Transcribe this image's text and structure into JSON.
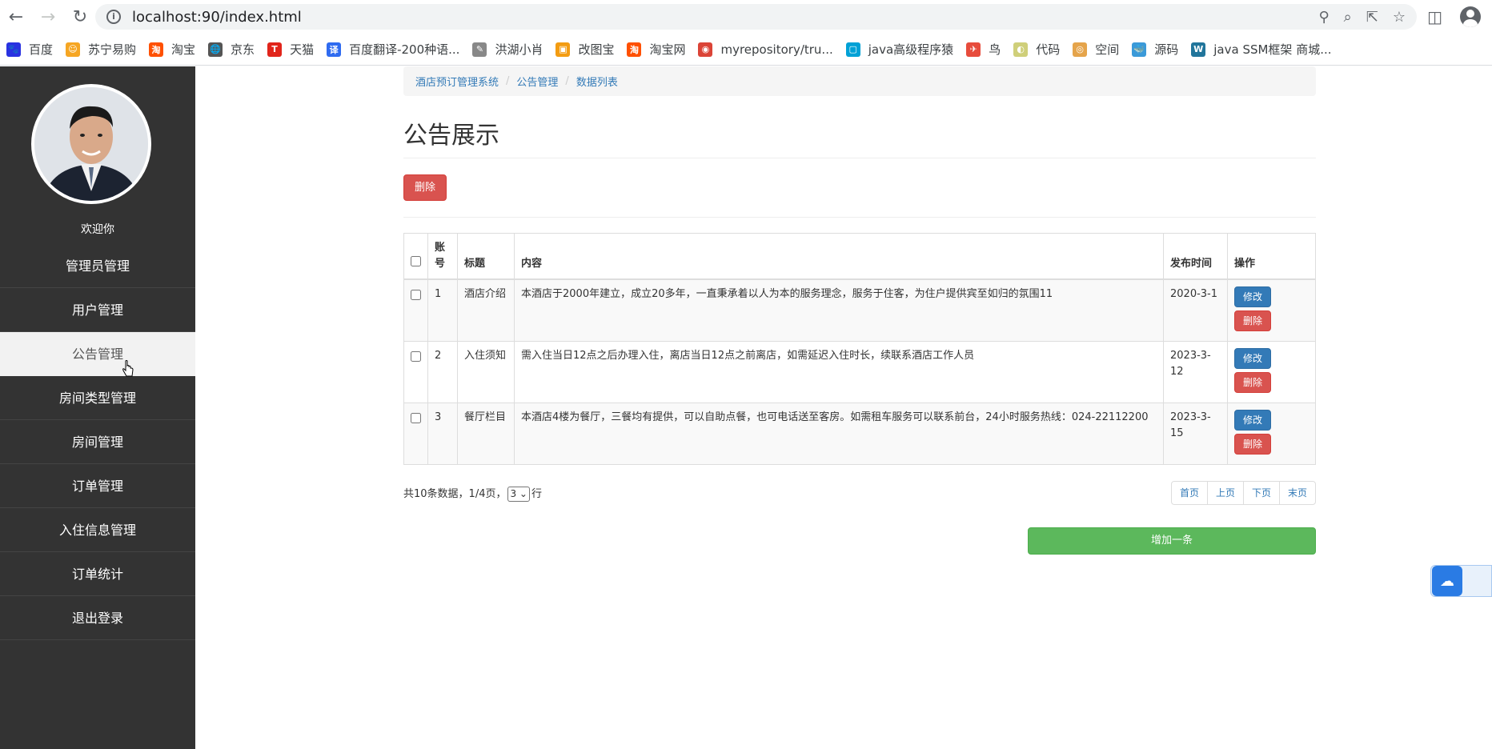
{
  "browser": {
    "url": "localhost:90/index.html",
    "bookmarks": [
      {
        "label": "百度",
        "icon": "baidu-icon",
        "color": "#2932e1",
        "glyph": "🐾"
      },
      {
        "label": "苏宁易购",
        "icon": "suning-icon",
        "color": "#f6a623",
        "glyph": "☺"
      },
      {
        "label": "淘宝",
        "icon": "taobao-icon",
        "color": "#ff5000",
        "glyph": "淘"
      },
      {
        "label": "京东",
        "icon": "jd-icon",
        "color": "#555555",
        "glyph": "🌐"
      },
      {
        "label": "天猫",
        "icon": "tmall-icon",
        "color": "#e1251b",
        "glyph": "T"
      },
      {
        "label": "百度翻译-200种语...",
        "icon": "baidu-translate-icon",
        "color": "#2f6bf0",
        "glyph": "译"
      },
      {
        "label": "洪湖小肖",
        "icon": "hhxx-icon",
        "color": "#888888",
        "glyph": "✎"
      },
      {
        "label": "改图宝",
        "icon": "gaitubao-icon",
        "color": "#f39c12",
        "glyph": "▣"
      },
      {
        "label": "淘宝网",
        "icon": "taobao-net-icon",
        "color": "#ff5000",
        "glyph": "淘"
      },
      {
        "label": "myrepository/tru...",
        "icon": "chrome-icon",
        "color": "#db4437",
        "glyph": "◉"
      },
      {
        "label": "java高级程序猿",
        "icon": "bilibili-icon",
        "color": "#00a1d6",
        "glyph": "▢"
      },
      {
        "label": "鸟",
        "icon": "bird-icon",
        "color": "#e74c3c",
        "glyph": "✈"
      },
      {
        "label": "代码",
        "icon": "code-icon",
        "color": "#cfcf7a",
        "glyph": "◐"
      },
      {
        "label": "空间",
        "icon": "qzone-icon",
        "color": "#e5a44b",
        "glyph": "◎"
      },
      {
        "label": "源码",
        "icon": "source-icon",
        "color": "#3b9ad9",
        "glyph": "🐳"
      },
      {
        "label": "java SSM框架 商城...",
        "icon": "wordpress-icon",
        "color": "#21759b",
        "glyph": "W"
      }
    ]
  },
  "sidebar": {
    "welcome": "欢迎你",
    "items": [
      {
        "label": "管理员管理",
        "active": false
      },
      {
        "label": "用户管理",
        "active": false
      },
      {
        "label": "公告管理",
        "active": true
      },
      {
        "label": "房间类型管理",
        "active": false
      },
      {
        "label": "房间管理",
        "active": false
      },
      {
        "label": "订单管理",
        "active": false
      },
      {
        "label": "入住信息管理",
        "active": false
      },
      {
        "label": "订单统计",
        "active": false
      },
      {
        "label": "退出登录",
        "active": false
      }
    ]
  },
  "breadcrumb": [
    "酒店预订管理系统",
    "公告管理",
    "数据列表"
  ],
  "page_title": "公告展示",
  "delete_button": "删除",
  "table": {
    "headers": [
      "账号",
      "标题",
      "内容",
      "发布时间",
      "操作"
    ],
    "rows": [
      {
        "id": "1",
        "title": "酒店介绍",
        "content": "本酒店于2000年建立，成立20多年，一直秉承着以人为本的服务理念，服务于住客，为住户提供宾至如归的氛围11",
        "date": "2020-3-1"
      },
      {
        "id": "2",
        "title": "入住须知",
        "content": "需入住当日12点之后办理入住，离店当日12点之前离店，如需延迟入住时长，续联系酒店工作人员",
        "date": "2023-3-12"
      },
      {
        "id": "3",
        "title": "餐厅栏目",
        "content": "本酒店4楼为餐厅，三餐均有提供，可以自助点餐，也可电话送至客房。如需租车服务可以联系前台，24小时服务热线：024-22112200",
        "date": "2023-3-15"
      }
    ],
    "edit_label": "修改",
    "delete_label": "删除"
  },
  "pager": {
    "summary": "共10条数据，1/4页，",
    "rows_select": "3",
    "rows_suffix": "行",
    "buttons": [
      "首页",
      "上页",
      "下页",
      "末页"
    ]
  },
  "add_button": "增加一条"
}
